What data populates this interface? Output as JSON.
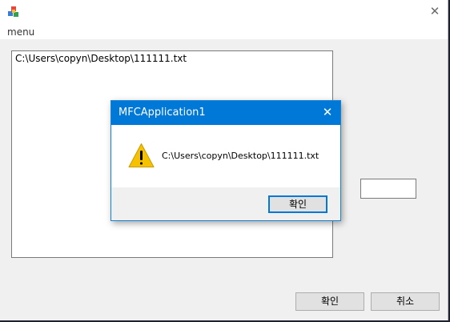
{
  "main_window": {
    "menu_label": "menu",
    "list_items": [
      "C:\\Users\\copyn\\Desktop\\111111.txt"
    ],
    "side_edit_value": "",
    "ok_button": "확인",
    "cancel_button": "취소"
  },
  "message_box": {
    "title": "MFCApplication1",
    "icon": "warning-icon",
    "message": "C:\\Users\\copyn\\Desktop\\111111.txt",
    "ok_button": "확인"
  },
  "colors": {
    "accent": "#0078d7",
    "warning": "#f6c200"
  }
}
